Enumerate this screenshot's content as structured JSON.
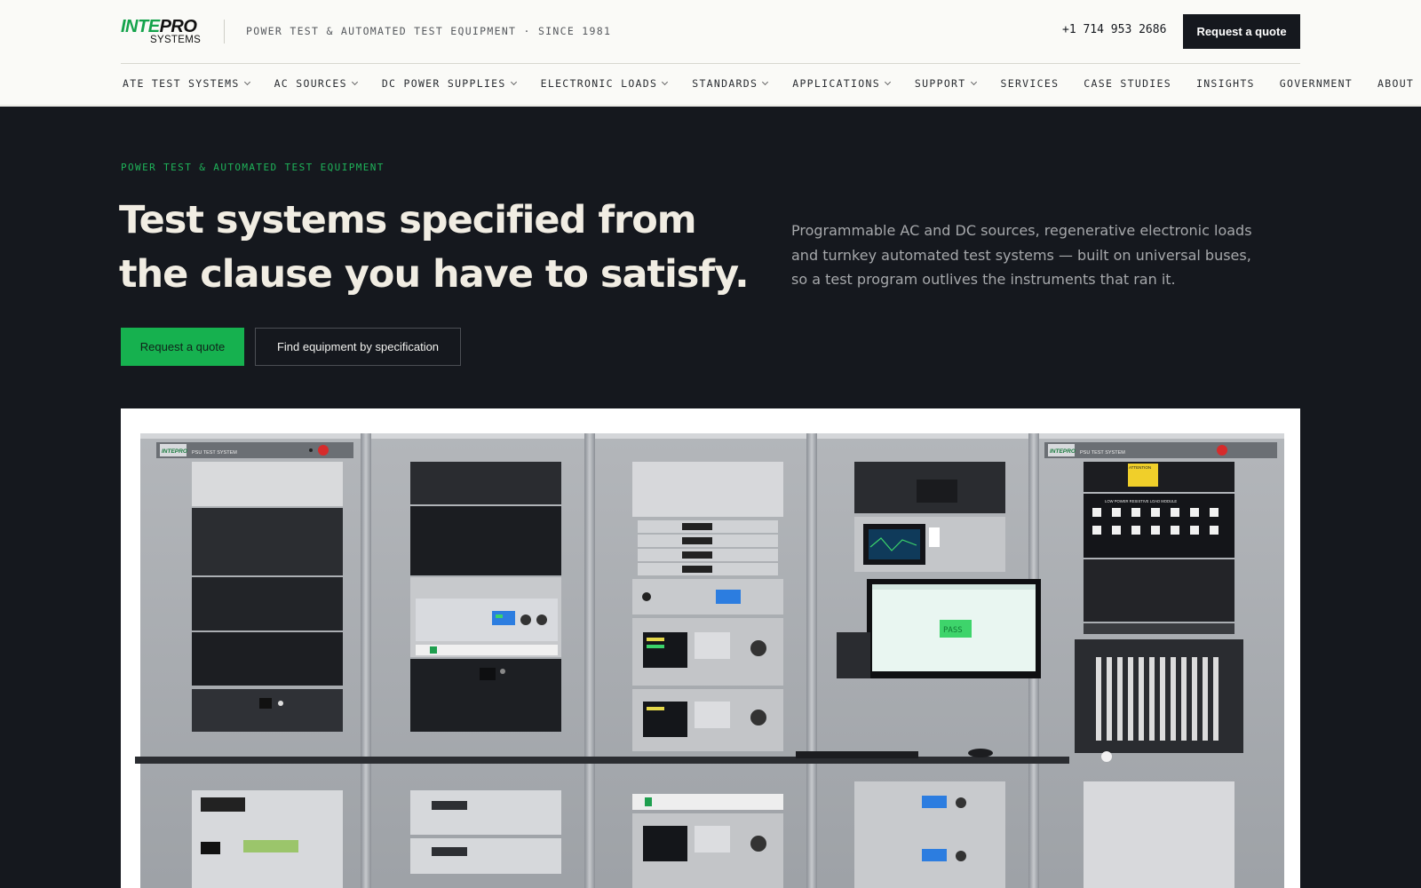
{
  "brand": {
    "logo_part1": "INTE",
    "logo_part2": "PRO",
    "logo_sub": "SYSTEMS",
    "tagline": "POWER TEST & AUTOMATED TEST EQUIPMENT · SINCE 1981",
    "accent_color": "#14a34b"
  },
  "header": {
    "phone": "+1 714 953 2686",
    "quote_label": "Request a quote"
  },
  "nav": {
    "items": [
      {
        "label": "ATE TEST SYSTEMS",
        "has_dropdown": true
      },
      {
        "label": "AC SOURCES",
        "has_dropdown": true
      },
      {
        "label": "DC POWER SUPPLIES",
        "has_dropdown": true
      },
      {
        "label": "ELECTRONIC LOADS",
        "has_dropdown": true
      },
      {
        "label": "STANDARDS",
        "has_dropdown": true
      },
      {
        "label": "APPLICATIONS",
        "has_dropdown": true
      },
      {
        "label": "SUPPORT",
        "has_dropdown": true
      },
      {
        "label": "SERVICES",
        "has_dropdown": false
      },
      {
        "label": "CASE STUDIES",
        "has_dropdown": false
      },
      {
        "label": "INSIGHTS",
        "has_dropdown": false
      },
      {
        "label": "GOVERNMENT",
        "has_dropdown": false
      },
      {
        "label": "ABOUT",
        "has_dropdown": false
      }
    ]
  },
  "hero": {
    "eyebrow": "POWER TEST & AUTOMATED TEST EQUIPMENT",
    "headline": "Test systems specified from the clause you have to satisfy.",
    "subcopy": "Programmable AC and DC sources, regenerative electronic loads and turnkey automated test systems — built on universal buses, so a test program outlives the instruments that ran it.",
    "primary_cta": "Request a quote",
    "secondary_cta": "Find equipment by specification",
    "background_color": "#15181e",
    "cta_color": "#16b14f"
  },
  "equipment_image": {
    "rack_label": "PSU TEST SYSTEM",
    "rack_logo": "INTEPRO",
    "attention_label": "ATTENTION",
    "module_label": "LOW POWER RESISTIVE LOAD MODULE",
    "screen_text": "PASS"
  }
}
